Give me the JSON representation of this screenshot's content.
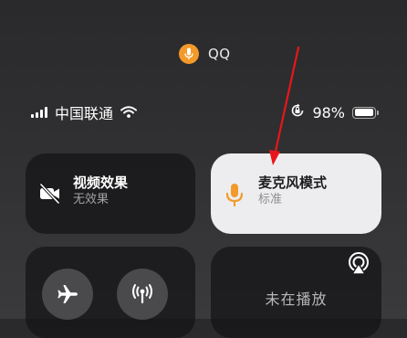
{
  "mic_indicator": {
    "app_name": "QQ",
    "dot_color": "#f39a2a"
  },
  "status_bar": {
    "carrier": "中国联通",
    "signal_bars": 4,
    "battery_percent": "98%",
    "battery_level": 0.98
  },
  "tiles": {
    "video_effects": {
      "title": "视频效果",
      "subtitle": "无效果",
      "icon": "video-off-icon"
    },
    "mic_mode": {
      "title": "麦克风模式",
      "subtitle": "标准",
      "icon": "microphone-icon",
      "icon_color": "#f39a2a"
    },
    "connectivity": {
      "buttons": [
        "airplane-icon",
        "cellular-antenna-icon"
      ]
    },
    "now_playing": {
      "status": "未在播放",
      "icon": "airplay-audio-icon"
    }
  },
  "annotation": {
    "arrow_color": "#e8161b"
  }
}
